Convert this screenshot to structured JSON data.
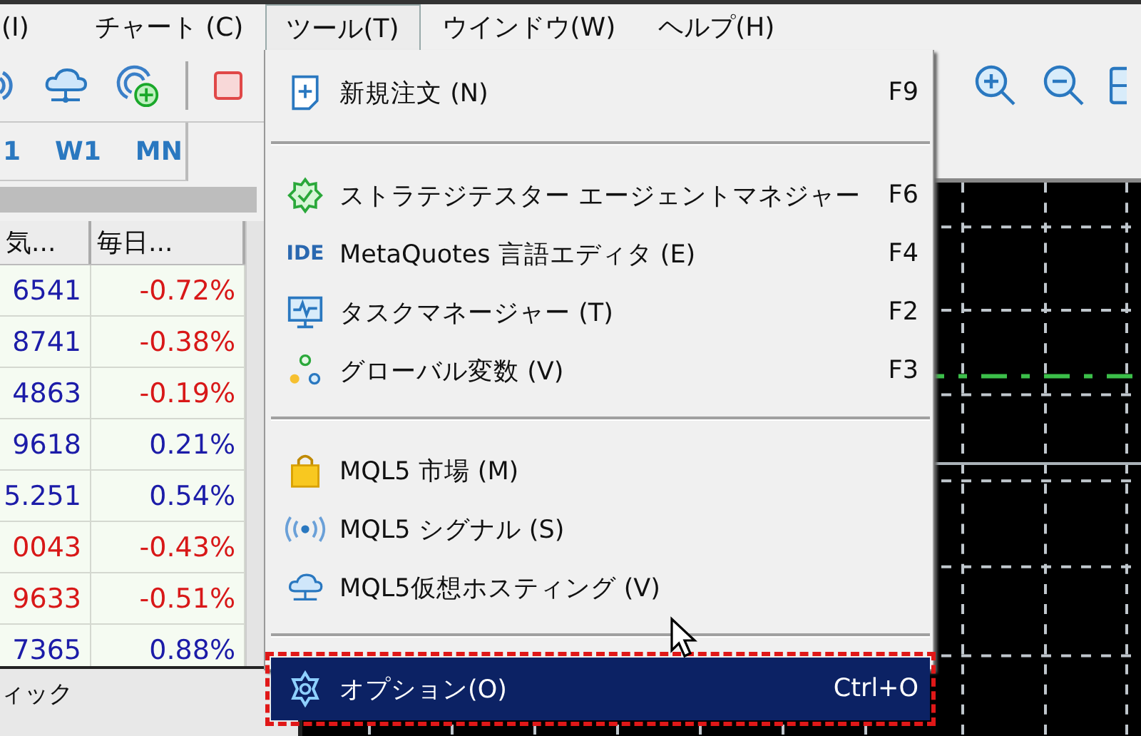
{
  "menu_bar": [
    {
      "label": "(I)",
      "selected": false
    },
    {
      "label": "チャート (C)",
      "selected": false
    },
    {
      "label": "ツール(T)",
      "selected": true
    },
    {
      "label": "ウインドウ(W)",
      "selected": false
    },
    {
      "label": "ヘルプ(H)",
      "selected": false
    }
  ],
  "timeframes": [
    "1",
    "W1",
    "MN"
  ],
  "market_watch": {
    "columns": [
      "気...",
      "毎日..."
    ],
    "rows": [
      {
        "bid": "6541",
        "bid_up": true,
        "change": "-0.72%",
        "change_up": false
      },
      {
        "bid": "8741",
        "bid_up": true,
        "change": "-0.38%",
        "change_up": false
      },
      {
        "bid": "4863",
        "bid_up": true,
        "change": "-0.19%",
        "change_up": false
      },
      {
        "bid": "9618",
        "bid_up": true,
        "change": "0.21%",
        "change_up": true
      },
      {
        "bid": "5.251",
        "bid_up": true,
        "change": "0.54%",
        "change_up": true
      },
      {
        "bid": "0043",
        "bid_up": false,
        "change": "-0.43%",
        "change_up": false
      },
      {
        "bid": "9633",
        "bid_up": false,
        "change": "-0.51%",
        "change_up": false
      },
      {
        "bid": "7365",
        "bid_up": true,
        "change": "0.88%",
        "change_up": true
      }
    ]
  },
  "bottom_tab": "ィック",
  "tools_menu": {
    "groups": [
      [
        {
          "label": "新規注文 (N)",
          "shortcut": "F9",
          "selected": false
        }
      ],
      [
        {
          "label": "ストラテジテスター エージェントマネジャー",
          "shortcut": "F6",
          "selected": false
        },
        {
          "icon_text": "IDE",
          "label": "MetaQuotes 言語エディタ (E)",
          "shortcut": "F4",
          "selected": false
        },
        {
          "label": "タスクマネージャー (T)",
          "shortcut": "F2",
          "selected": false
        },
        {
          "label": "グローバル変数 (V)",
          "shortcut": "F3",
          "selected": false
        }
      ],
      [
        {
          "label": "MQL5 市場 (M)",
          "selected": false
        },
        {
          "label": "MQL5 シグナル (S)",
          "selected": false
        },
        {
          "label": "MQL5仮想ホスティング (V)",
          "selected": false
        }
      ],
      [
        {
          "label": "オプション(O)",
          "shortcut": "Ctrl+O",
          "selected": true
        }
      ]
    ]
  }
}
